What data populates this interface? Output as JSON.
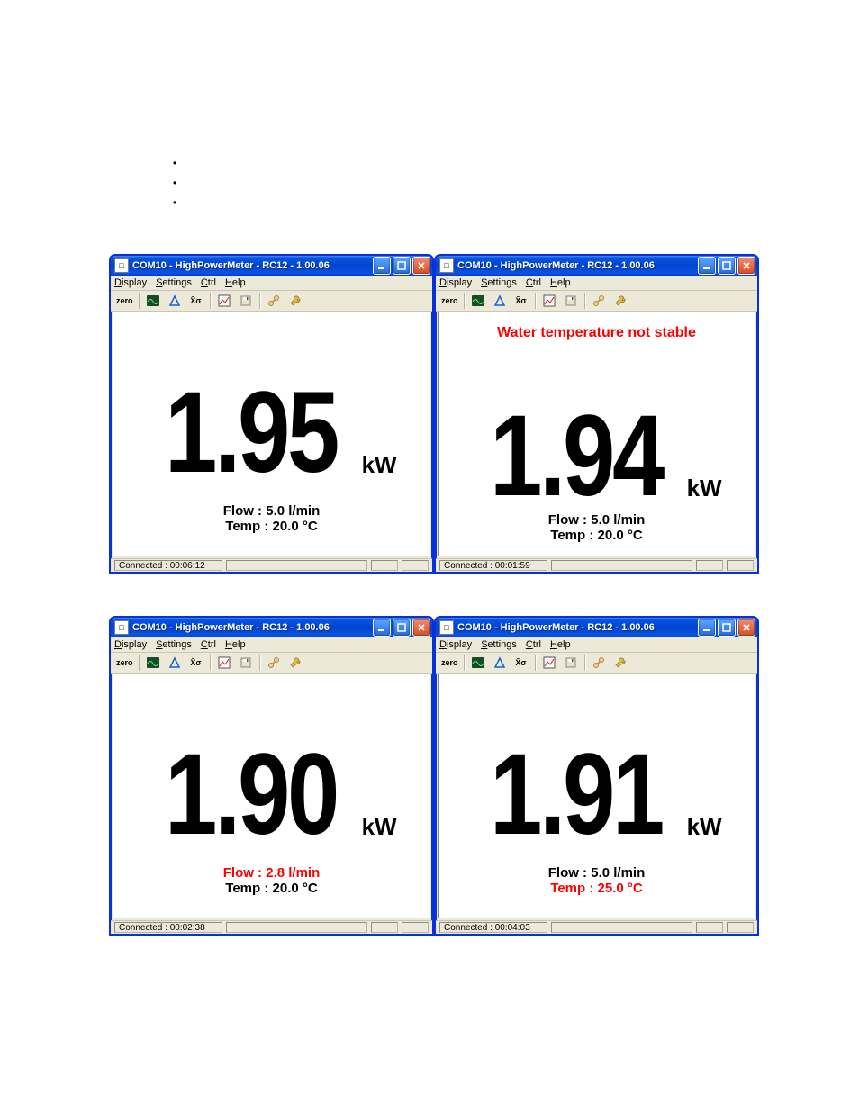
{
  "bullets": [
    "",
    "",
    ""
  ],
  "toolbar_labels": {
    "zero": "zero",
    "xbar": "X̄σ"
  },
  "menu": {
    "display": "Display",
    "settings": "Settings",
    "ctrl": "Ctrl",
    "help": "Help"
  },
  "windows": [
    {
      "title": "COM10 - HighPowerMeter - RC12 - 1.00.06",
      "warning": "",
      "value": "1.95",
      "unit": "kW",
      "flow": "Flow : 5.0 l/min",
      "flow_red": false,
      "temp": "Temp : 20.0 °C",
      "temp_red": false,
      "status": "Connected : 00:06:12"
    },
    {
      "title": "COM10 - HighPowerMeter - RC12 - 1.00.06",
      "warning": "Water temperature not stable",
      "value": "1.94",
      "unit": "kW",
      "flow": "Flow : 5.0 l/min",
      "flow_red": false,
      "temp": "Temp : 20.0 °C",
      "temp_red": false,
      "status": "Connected : 00:01:59"
    },
    {
      "title": "COM10 - HighPowerMeter - RC12 - 1.00.06",
      "warning": "",
      "value": "1.90",
      "unit": "kW",
      "flow": "Flow : 2.8 l/min",
      "flow_red": true,
      "temp": "Temp : 20.0 °C",
      "temp_red": false,
      "status": "Connected : 00:02:38"
    },
    {
      "title": "COM10 - HighPowerMeter - RC12 - 1.00.06",
      "warning": "",
      "value": "1.91",
      "unit": "kW",
      "flow": "Flow : 5.0 l/min",
      "flow_red": false,
      "temp": "Temp : 25.0 °C",
      "temp_red": true,
      "status": "Connected : 00:04:03"
    }
  ]
}
